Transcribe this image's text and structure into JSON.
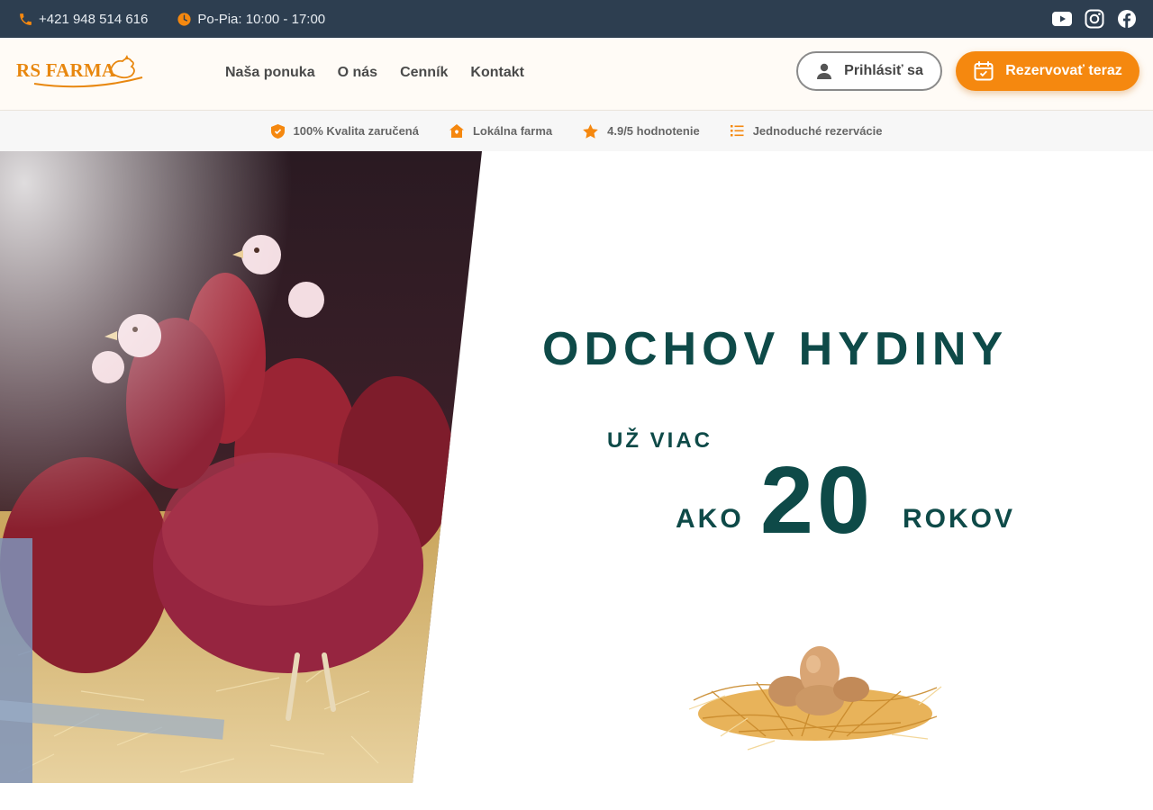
{
  "topbar": {
    "phone": "+421 948 514 616",
    "hours": "Po-Pia: 10:00 - 17:00",
    "social": [
      "youtube-icon",
      "instagram-icon",
      "facebook-icon"
    ]
  },
  "header": {
    "logo_text": "RS FARMA",
    "nav": [
      "Naša ponuka",
      "O nás",
      "Cenník",
      "Kontakt"
    ],
    "login_label": "Prihlásiť sa",
    "reserve_label": "Rezervovať teraz"
  },
  "features": [
    {
      "icon": "shield-icon",
      "label": "100% Kvalita zaručená"
    },
    {
      "icon": "home-icon",
      "label": "Lokálna farma"
    },
    {
      "icon": "star-icon",
      "label": "4.9/5 hodnotenie"
    },
    {
      "icon": "list-icon",
      "label": "Jednoduché rezervácie"
    }
  ],
  "hero": {
    "title": "ODCHOV HYDINY",
    "since": "UŽ VIAC",
    "ago": "AKO",
    "number": "20",
    "years": "ROKOV"
  },
  "colors": {
    "topbar": "#2d3e50",
    "accent": "#f5880f",
    "hero_text": "#0e4a48"
  }
}
